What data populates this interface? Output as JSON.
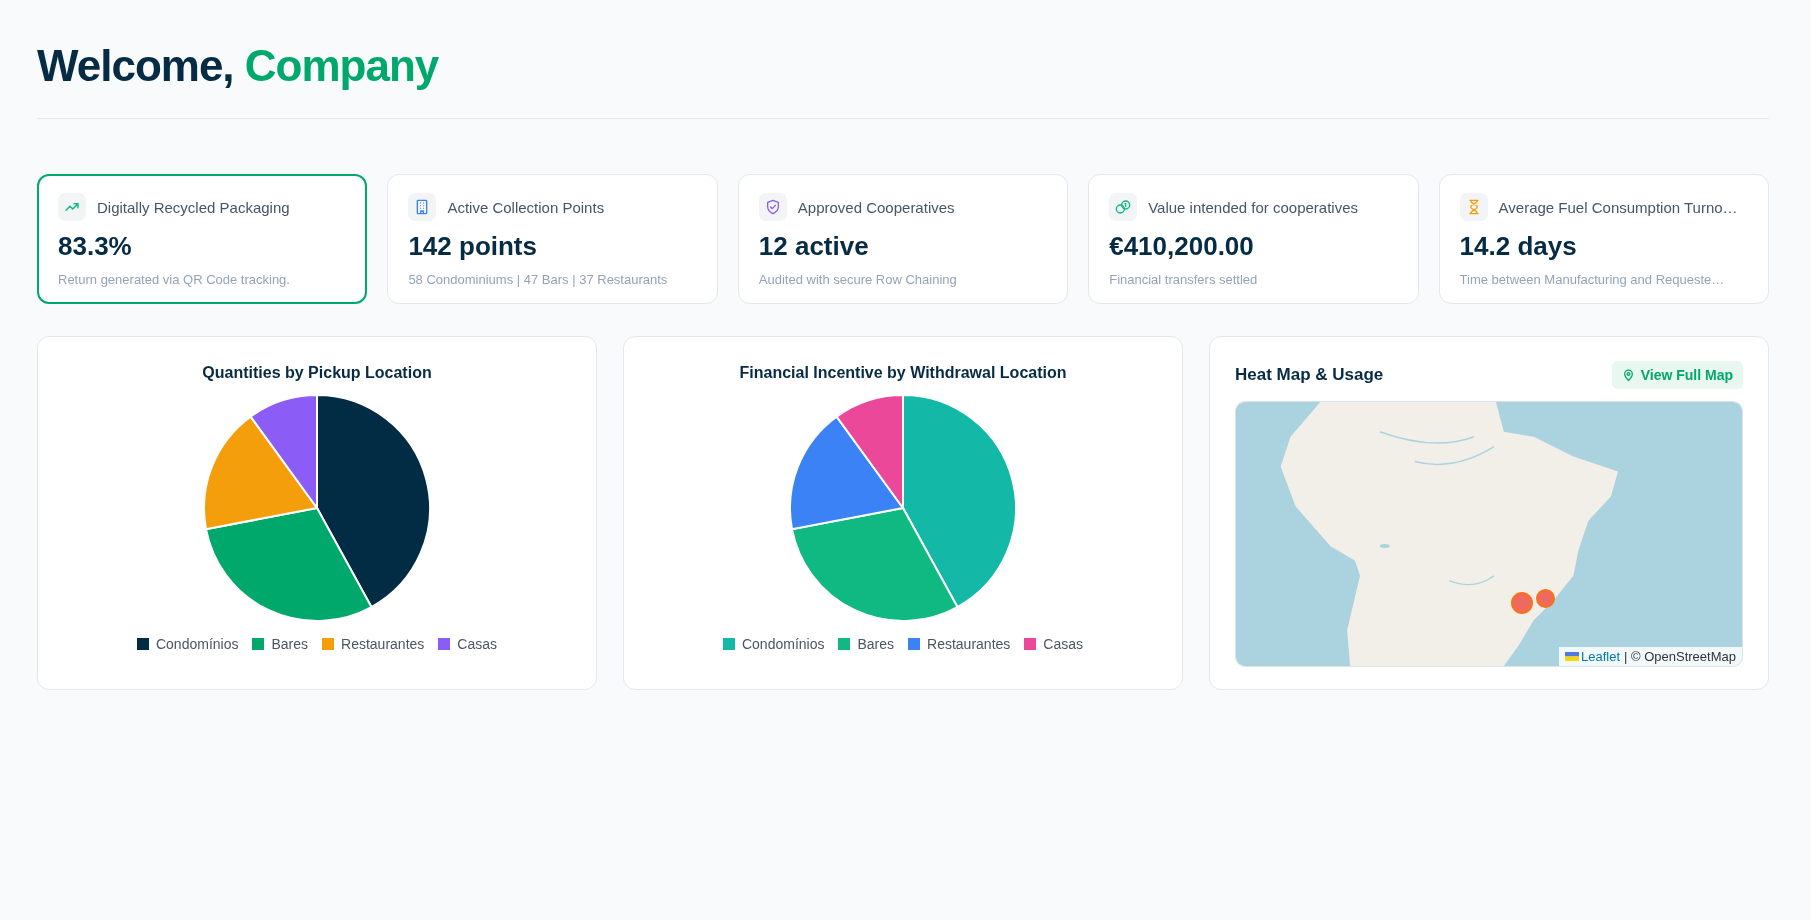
{
  "header": {
    "greeting": "Welcome,",
    "name": "Company"
  },
  "stats": [
    {
      "kind": "trend",
      "title": "Digitally Recycled Packaging",
      "value": "83.3%",
      "note": "Return generated via QR Code tracking.",
      "selected": true
    },
    {
      "kind": "building",
      "title": "Active Collection Points",
      "value": "142 points",
      "note": "58 Condominiums | 47 Bars | 37 Restaurants",
      "selected": false
    },
    {
      "kind": "shield",
      "title": "Approved Cooperatives",
      "value": "12 active",
      "note": "Audited with secure Row Chaining",
      "selected": false
    },
    {
      "kind": "coins",
      "title": "Value intended for cooperatives",
      "value": "€410,200.00",
      "note": "Financial transfers settled",
      "selected": false
    },
    {
      "kind": "hourglass",
      "title": "Average Fuel Consumption Turno…",
      "value": "14.2 days",
      "note": "Time between Manufacturing and Requeste…",
      "selected": false
    }
  ],
  "charts": [
    {
      "chart_data": {
        "type": "pie",
        "title": "Quantities by Pickup Location",
        "categories": [
          "Condomínios",
          "Bares",
          "Restaurantes",
          "Casas"
        ],
        "values": [
          42,
          30,
          18,
          10
        ],
        "colors": [
          "#022c43",
          "#00a86b",
          "#f59e0b",
          "#8b5cf6"
        ]
      }
    },
    {
      "chart_data": {
        "type": "pie",
        "title": "Financial Incentive by Withdrawal Location",
        "categories": [
          "Condomínios",
          "Bares",
          "Restaurantes",
          "Casas"
        ],
        "values": [
          42,
          30,
          18,
          10
        ],
        "colors": [
          "#14b8a6",
          "#10b981",
          "#3b82f6",
          "#ec4899"
        ]
      }
    }
  ],
  "map": {
    "title": "Heat Map & Usage",
    "button": "View Full Map",
    "attribution_link": "Leaflet",
    "attribution_text": "| © OpenStreetMap"
  }
}
